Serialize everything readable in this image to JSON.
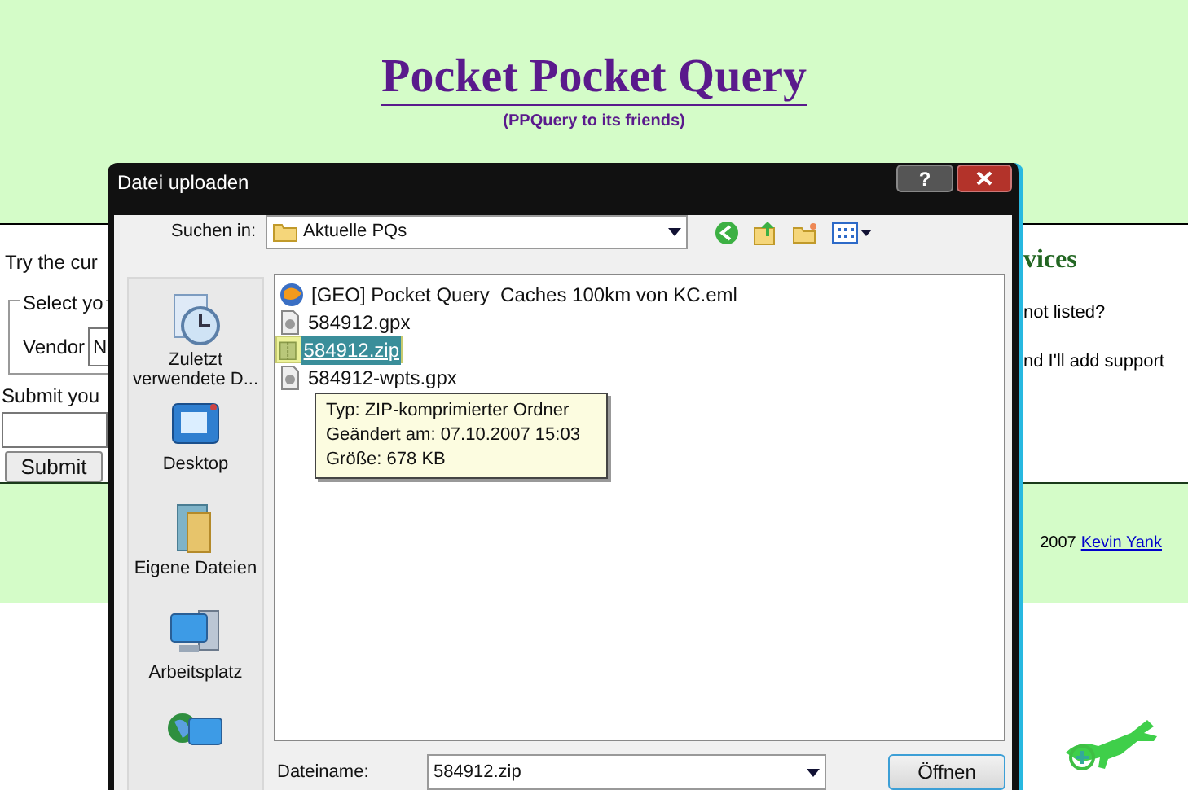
{
  "page": {
    "title": "Pocket Pocket Query",
    "subtitle": "(PPQuery to its friends)",
    "intro_text": "Try the cur",
    "fieldset_legend": "Select yo",
    "vendor_label": "Vendor",
    "vendor_value": "N",
    "submit_label": "Submit you",
    "submit_button": "Submit",
    "right_heading": "vices",
    "right_texts": [
      "not listed?",
      "nd I'll add support"
    ],
    "footer_year": "2007",
    "footer_link": "Kevin Yank"
  },
  "dialog": {
    "title": "Datei uploaden",
    "help_button": "?",
    "look_in_label": "Suchen in:",
    "look_in_value": "Aktuelle PQs",
    "places": [
      {
        "kind": "recent",
        "label": "Zuletzt verwendete D..."
      },
      {
        "kind": "desktop",
        "label": "Desktop"
      },
      {
        "kind": "documents",
        "label": "Eigene Dateien"
      },
      {
        "kind": "computer",
        "label": "Arbeitsplatz"
      },
      {
        "kind": "network"
      }
    ],
    "files": [
      {
        "kind": "mail",
        "name": "[GEO] Pocket Query  Caches 100km von KC.eml",
        "selected": false
      },
      {
        "kind": "document",
        "name": "584912.gpx",
        "selected": false
      },
      {
        "kind": "zip",
        "name": "584912.zip",
        "selected": true
      },
      {
        "kind": "document",
        "name": "584912-wpts.gpx",
        "selected": false
      }
    ],
    "tooltip": [
      "Typ: ZIP-komprimierter Ordner",
      "Geändert am: 07.10.2007 15:03",
      "Größe: 678 KB"
    ],
    "filename_label": "Dateiname:",
    "filename_value": "584912.zip",
    "open_button": "Öffnen"
  }
}
